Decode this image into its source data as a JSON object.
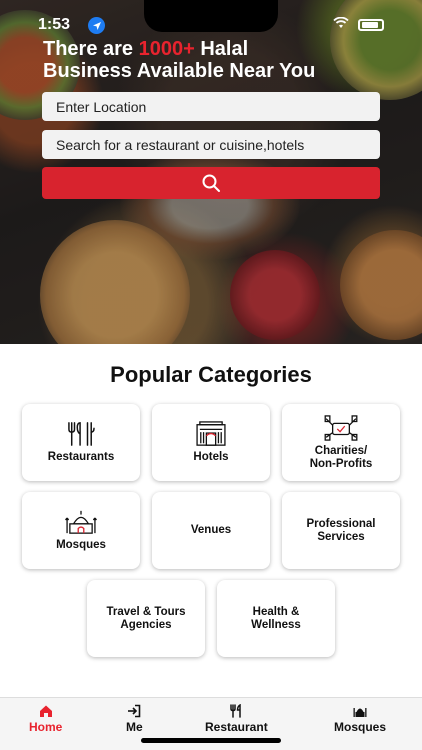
{
  "status_bar": {
    "time": "1:53"
  },
  "hero": {
    "headline_prefix": "There are ",
    "headline_count": "1000+",
    "headline_suffix_line1": " Halal",
    "headline_line2": "Business Available Near You",
    "location_placeholder": "Enter Location",
    "search_placeholder": "Search for a restaurant or cuisine,hotels"
  },
  "categories": {
    "title": "Popular Categories",
    "items": [
      {
        "label": "Restaurants",
        "icon": "cutlery-icon"
      },
      {
        "label": "Hotels",
        "icon": "hotel-icon"
      },
      {
        "label_line1": "Charities/",
        "label_line2": "Non-Profits",
        "icon": "charity-hands-icon"
      },
      {
        "label": "Mosques",
        "icon": "mosque-icon"
      },
      {
        "label": "Venues"
      },
      {
        "label_line1": "Professional",
        "label_line2": "Services"
      },
      {
        "label_line1": "Travel & Tours",
        "label_line2": "Agencies"
      },
      {
        "label_line1": "Health &",
        "label_line2": "Wellness"
      }
    ]
  },
  "tab_bar": {
    "items": [
      {
        "label": "Home",
        "icon": "home-icon",
        "active": true
      },
      {
        "label": "Me",
        "icon": "login-icon",
        "active": false
      },
      {
        "label": "Restaurant",
        "icon": "fork-knife-icon",
        "active": false
      },
      {
        "label": "Mosques",
        "icon": "mosque-icon",
        "active": false
      }
    ]
  },
  "colors": {
    "accent": "#e8232e",
    "button": "#d8232e"
  }
}
